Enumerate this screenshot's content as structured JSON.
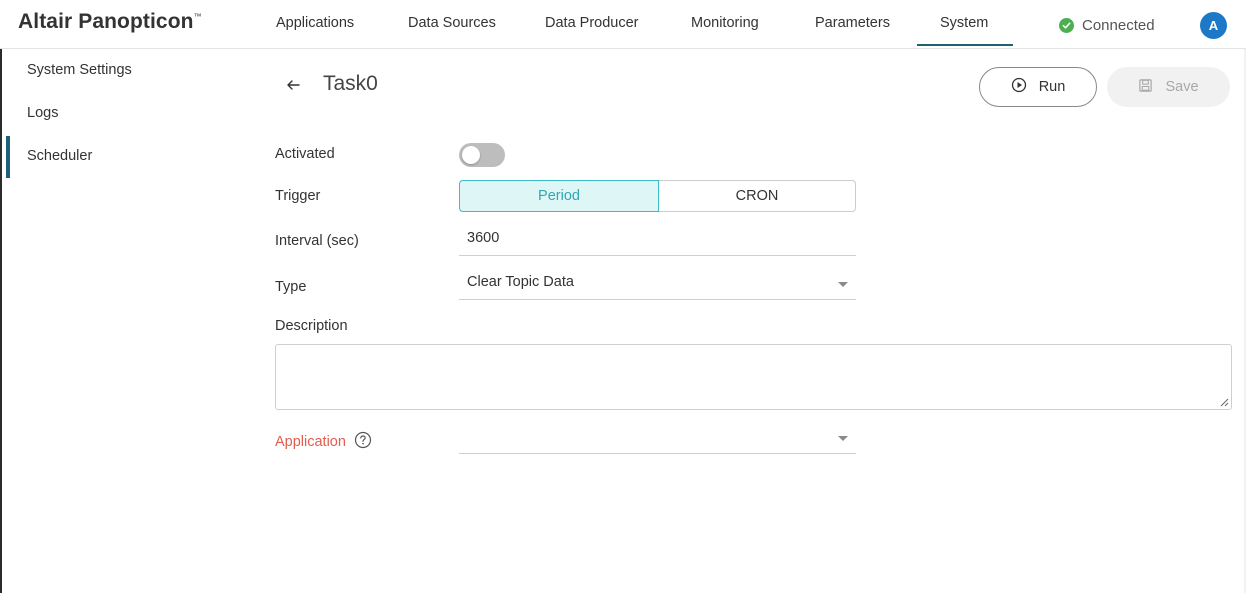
{
  "brand": {
    "name": "Altair Panopticon",
    "trademark": "™"
  },
  "nav": {
    "items": [
      {
        "label": "Applications"
      },
      {
        "label": "Data Sources"
      },
      {
        "label": "Data Producer"
      },
      {
        "label": "Monitoring"
      },
      {
        "label": "Parameters"
      },
      {
        "label": "System",
        "active": true
      }
    ]
  },
  "status": {
    "label": "Connected",
    "color": "#4caf50"
  },
  "avatar": {
    "initial": "A",
    "color": "#1e78c8"
  },
  "sidebar": {
    "items": [
      {
        "label": "System Settings"
      },
      {
        "label": "Logs"
      },
      {
        "label": "Scheduler",
        "active": true
      }
    ]
  },
  "page": {
    "title": "Task0"
  },
  "actions": {
    "run_label": "Run",
    "save_label": "Save",
    "save_disabled": true
  },
  "form": {
    "activated": {
      "label": "Activated",
      "on": false
    },
    "trigger": {
      "label": "Trigger",
      "options": [
        "Period",
        "CRON"
      ],
      "selected": "Period"
    },
    "interval": {
      "label": "Interval (sec)",
      "value": "3600"
    },
    "type": {
      "label": "Type",
      "value": "Clear Topic Data"
    },
    "description": {
      "label": "Description",
      "value": ""
    },
    "application": {
      "label": "Application",
      "value": ""
    }
  },
  "colors": {
    "accent": "#1f5f78",
    "segment_active": "#3cbcc6",
    "required": "#e25d4d"
  },
  "icons": {
    "back": "arrow-left-icon",
    "run": "play-circle-icon",
    "save": "save-disk-icon",
    "status": "check-circle-icon",
    "help": "help-circle-icon",
    "dropdown": "caret-down-icon"
  }
}
